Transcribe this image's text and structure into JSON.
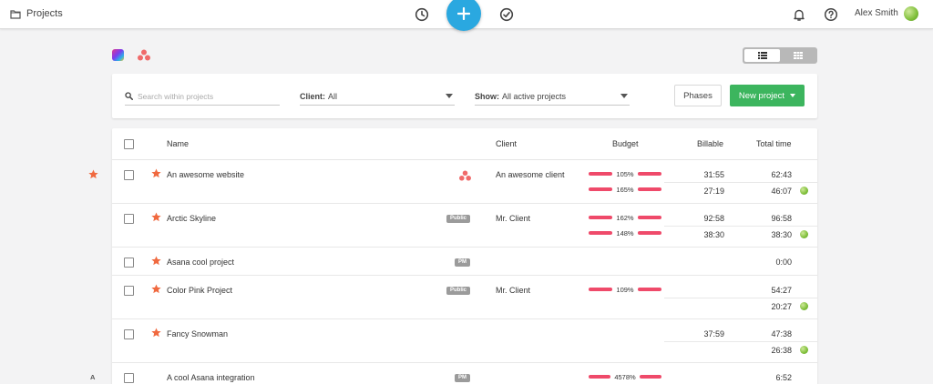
{
  "header": {
    "title": "Projects",
    "user_name": "Alex Smith"
  },
  "filters": {
    "search_placeholder": "Search within projects",
    "client_label": "Client:",
    "client_value": "All",
    "show_label": "Show:",
    "show_value": "All active projects",
    "phases_label": "Phases",
    "new_project_label": "New project"
  },
  "table": {
    "columns": {
      "name": "Name",
      "client": "Client",
      "budget": "Budget",
      "billable": "Billable",
      "total": "Total time"
    },
    "rows": [
      {
        "name": "An awesome website",
        "client": "An awesome client",
        "budget1": "105%",
        "budget2": "165%",
        "billable1": "31:55",
        "billable2": "27:19",
        "total1": "62:43",
        "total2": "46:07"
      },
      {
        "name": "Arctic Skyline",
        "badge": "Public",
        "client": "Mr. Client",
        "budget1": "162%",
        "budget2": "148%",
        "billable1": "92:58",
        "billable2": "38:30",
        "total1": "96:58",
        "total2": "38:30"
      },
      {
        "name": "Asana cool project",
        "badge": "PM",
        "total1": "0:00"
      },
      {
        "name": "Color Pink Project",
        "badge": "Public",
        "client": "Mr. Client",
        "budget1": "109%",
        "total1": "54:27",
        "total2": "20:27"
      },
      {
        "name": "Fancy Snowman",
        "billable1": "37:59",
        "total1": "47:38",
        "total2": "26:38"
      },
      {
        "name": "A cool Asana integration",
        "badge": "PM",
        "budget1": "4578%",
        "total1": "6:52"
      }
    ],
    "side_letter": "A"
  },
  "colors": {
    "accent_blue": "#2aa8e0",
    "green_button": "#3cb55e",
    "budget_bar": "#ef4a6a",
    "star": "#f0693f"
  }
}
